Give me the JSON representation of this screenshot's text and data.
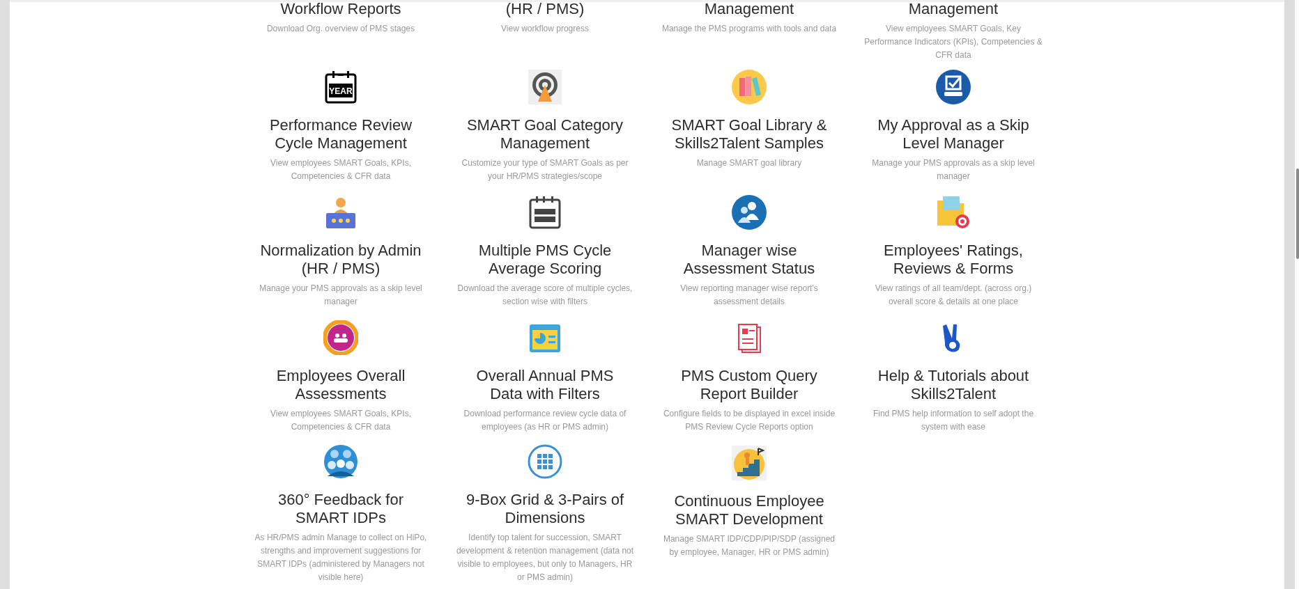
{
  "top_row": [
    {
      "title": "Workflow Reports",
      "description": "Download Org. overview of PMS stages"
    },
    {
      "title": "(HR / PMS)",
      "description": "View workflow progress"
    },
    {
      "title": "Management",
      "description": "Manage the PMS programs with tools and data"
    },
    {
      "title": "Management",
      "description": "View employees SMART Goals, Key Performance Indicators (KPIs), Competencies & CFR data"
    }
  ],
  "cards": [
    {
      "title": "Performance Review Cycle Management",
      "description": "View employees SMART Goals, KPIs, Competencies & CFR data",
      "icon_text": "YEAR"
    },
    {
      "title": "SMART Goal Category Management",
      "description": "Customize your type of SMART Goals as per your HR/PMS strategies/scope"
    },
    {
      "title": "SMART Goal Library & Skills2Talent Samples",
      "description": "Manage SMART goal library"
    },
    {
      "title": "My Approval as a Skip Level Manager",
      "description": "Manage your PMS approvals as a skip level manager"
    },
    {
      "title": "Normalization by Admin (HR / PMS)",
      "description": "Manage your PMS approvals as a skip level manager"
    },
    {
      "title": "Multiple PMS Cycle Average Scoring",
      "description": "Download the average score of multiple cycles, section wise with filters"
    },
    {
      "title": "Manager wise Assessment Status",
      "description": "View reporting manager wise report's assessment details"
    },
    {
      "title": "Employees' Ratings, Reviews & Forms",
      "description": "View ratings of all team/dept. (across org.) overall score & details at one place"
    },
    {
      "title": "Employees Overall Assessments",
      "description": "View employees SMART Goals, KPIs, Competencies & CFR data"
    },
    {
      "title": "Overall Annual PMS Data with Filters",
      "description": "Download performance review cycle data of employees (as HR or PMS admin)"
    },
    {
      "title": "PMS Custom Query Report Builder",
      "description": "Configure fields to be displayed in excel inside PMS Review Cycle Reports option"
    },
    {
      "title": "Help & Tutorials about Skills2Talent",
      "description": "Find PMS help information to self adopt the system with ease"
    },
    {
      "title": "360° Feedback for SMART IDPs",
      "description": "As HR/PMS admin Manage to collect on HiPo, strengths and improvement suggestions for SMART IDPs (administered by Managers not visible here)"
    },
    {
      "title": "9-Box Grid & 3-Pairs of Dimensions",
      "description": "Identify top talent for succession, SMART development & retention management (data not visible to employees, but only to Managers, HR or PMS admin)"
    },
    {
      "title": "Continuous Employee SMART Development",
      "description": "Manage SMART IDP/CDP/PIP/SDP (assigned by employee, Manager, HR or PMS admin)"
    }
  ]
}
